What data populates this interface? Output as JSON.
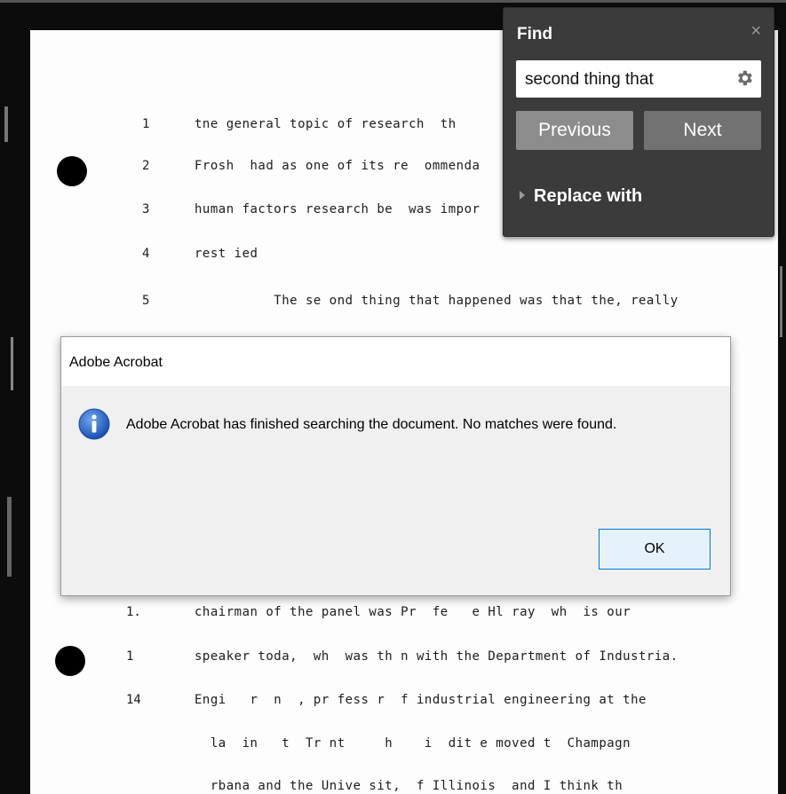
{
  "document": {
    "lines": [
      {
        "num": "1",
        "text": "tne general topic of research  th"
      },
      {
        "num": "2",
        "text": "Frosh  had as one of its re  ommenda"
      },
      {
        "num": "3",
        "text": "human factors research be  was impor"
      },
      {
        "num": "4",
        "text": "rest ied"
      },
      {
        "num": "5",
        "text": "          The se ond thing that happened was that the, really"
      },
      {
        "num": "1.",
        "text": "chairman of the panel was Pr  fe   e Hl ray  wh  is our"
      },
      {
        "num": "1 ",
        "text": "speaker toda,  wh  was th n with the Department of Industria."
      },
      {
        "num": "14",
        "text": "Engi   r  n  , pr fess r  f industrial engineering at the"
      },
      {
        "num": "",
        "text": "  la  in   t  Tr nt     h    i  dit e moved t  Champagn"
      },
      {
        "num": "",
        "text": "  rbana and the Unive sit,  f Illinois  and I think th"
      }
    ]
  },
  "find_panel": {
    "title": "Find",
    "close_glyph": "×",
    "search_value": "second thing that",
    "previous_label": "Previous",
    "next_label": "Next",
    "replace_label": "Replace with"
  },
  "dialog": {
    "title": "Adobe Acrobat",
    "message": "Adobe Acrobat has finished searching the document. No matches were found.",
    "ok_label": "OK"
  },
  "colors": {
    "find_bg": "#3b3b3b",
    "button_primary": "#727272",
    "button_disabled": "#8c8c8c",
    "ok_border": "#0078d7",
    "info_blue": "#1e63c4"
  }
}
